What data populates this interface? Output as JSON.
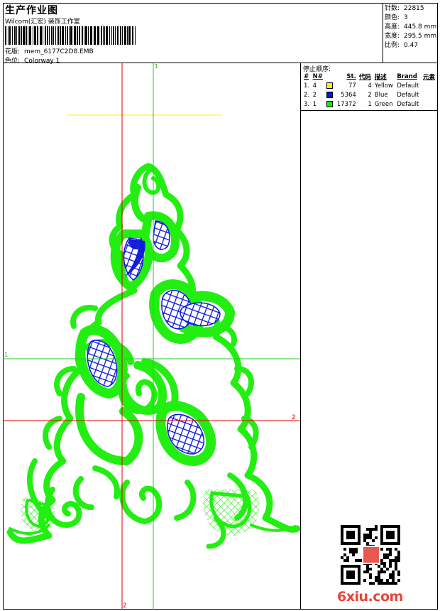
{
  "header": {
    "title": "生产作业图",
    "company": "Wilcom(汇宏) 装饰工作室",
    "design_label": "花版:",
    "design_value": "mem_6177C2D8.EMB",
    "color_label": "色位:",
    "color_value": "Colorway 1"
  },
  "stats": {
    "stitches_label": "针数:",
    "stitches_value": "22815",
    "colors_label": "颜色:",
    "colors_value": "3",
    "height_label": "高度:",
    "height_value": "445.8 mm",
    "width_label": "宽度:",
    "width_value": "295.5 mm",
    "scale_label": "比例:",
    "scale_value": "0.47"
  },
  "sequence": {
    "title": "停止顺序:",
    "headers": [
      "#",
      "N#",
      "",
      "St.",
      "代码",
      "描述",
      "Brand",
      "元素"
    ],
    "rows": [
      {
        "idx": "1.",
        "n": "4",
        "color": "#ffee00",
        "st": "77",
        "code": "4",
        "desc": "Yellow",
        "brand": "Default"
      },
      {
        "idx": "2.",
        "n": "2",
        "color": "#0015e0",
        "st": "5364",
        "code": "2",
        "desc": "Blue",
        "brand": "Default"
      },
      {
        "idx": "3.",
        "n": "1",
        "color": "#10ee10",
        "st": "17372",
        "code": "1",
        "desc": "Green",
        "brand": "Default"
      }
    ]
  },
  "canvas": {
    "axis_labels": {
      "v_top": "1",
      "h_left": "1",
      "h_right": "2",
      "v_bottom": "2"
    },
    "colors": {
      "green": "#22ee11",
      "blue": "#0a17d8",
      "red_axis": "#dd0000",
      "green_axis": "#22cc22",
      "yellow": "#ffee00"
    }
  },
  "watermark": {
    "text": "6xiu.com"
  }
}
